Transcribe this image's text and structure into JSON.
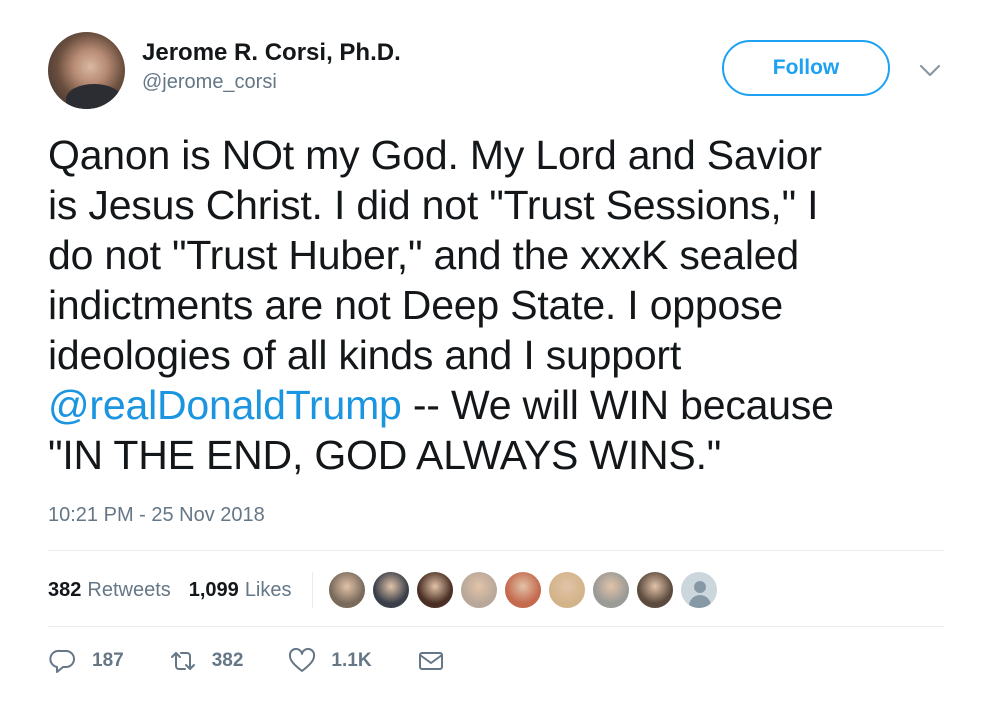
{
  "author": {
    "display_name": "Jerome R. Corsi, Ph.D.",
    "handle": "@jerome_corsi"
  },
  "follow_label": "Follow",
  "tweet": {
    "lines": [
      "Qanon is NOt my God.  My Lord and Savior",
      "is Jesus Christ.  I did not \"Trust Sessions,\" I",
      "do not \"Trust Huber,\" and the xxxK sealed",
      "indictments are not Deep State. I oppose",
      "ideologies of all kinds and I support"
    ],
    "mention": "@realDonaldTrump",
    "after_mention": " -- We will WIN because",
    "last_line": "\"IN THE END, GOD ALWAYS WINS.\""
  },
  "timestamp": "10:21 PM - 25 Nov 2018",
  "stats": {
    "retweets_count": "382",
    "retweets_label": "Retweets",
    "likes_count": "1,099",
    "likes_label": "Likes"
  },
  "actions": {
    "reply_count": "187",
    "retweet_count": "382",
    "like_count": "1.1K"
  },
  "colors": {
    "accent": "#1da1f2",
    "link": "#1b95e0",
    "secondary_text": "#657786",
    "divider": "#e6ecf0"
  },
  "likers": [
    {
      "icon": "liker-avatar",
      "color": "#7a6a5c"
    },
    {
      "icon": "liker-avatar",
      "color": "#3a3f4a"
    },
    {
      "icon": "liker-avatar",
      "color": "#4a2f24"
    },
    {
      "icon": "liker-avatar",
      "color": "#b9a89a"
    },
    {
      "icon": "liker-avatar",
      "color": "#c46a4e"
    },
    {
      "icon": "liker-avatar",
      "color": "#d3b48a"
    },
    {
      "icon": "liker-avatar",
      "color": "#9a9a96"
    },
    {
      "icon": "liker-avatar",
      "color": "#5b4a3e"
    },
    {
      "icon": "default-avatar",
      "color": "#ccd6dd"
    }
  ]
}
